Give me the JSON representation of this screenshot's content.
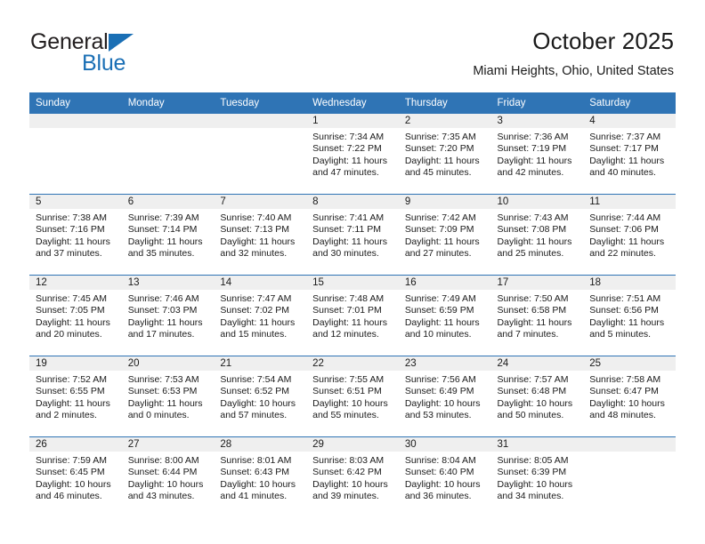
{
  "brand": {
    "name_part1": "General",
    "name_part2": "Blue",
    "flag_icon": "triangle-flag-icon"
  },
  "header": {
    "title": "October 2025",
    "subtitle": "Miami Heights, Ohio, United States"
  },
  "colors": {
    "header_blue": "#2f74b5",
    "brand_blue": "#1a6fb5",
    "daynum_strip": "#efefef",
    "text": "#1a1a1a"
  },
  "weekday_headers": [
    "Sunday",
    "Monday",
    "Tuesday",
    "Wednesday",
    "Thursday",
    "Friday",
    "Saturday"
  ],
  "weeks": [
    [
      {
        "day": "",
        "sunrise": "",
        "sunset": "",
        "daylight_line1": "",
        "daylight_line2": ""
      },
      {
        "day": "",
        "sunrise": "",
        "sunset": "",
        "daylight_line1": "",
        "daylight_line2": ""
      },
      {
        "day": "",
        "sunrise": "",
        "sunset": "",
        "daylight_line1": "",
        "daylight_line2": ""
      },
      {
        "day": "1",
        "sunrise": "Sunrise: 7:34 AM",
        "sunset": "Sunset: 7:22 PM",
        "daylight_line1": "Daylight: 11 hours",
        "daylight_line2": "and 47 minutes."
      },
      {
        "day": "2",
        "sunrise": "Sunrise: 7:35 AM",
        "sunset": "Sunset: 7:20 PM",
        "daylight_line1": "Daylight: 11 hours",
        "daylight_line2": "and 45 minutes."
      },
      {
        "day": "3",
        "sunrise": "Sunrise: 7:36 AM",
        "sunset": "Sunset: 7:19 PM",
        "daylight_line1": "Daylight: 11 hours",
        "daylight_line2": "and 42 minutes."
      },
      {
        "day": "4",
        "sunrise": "Sunrise: 7:37 AM",
        "sunset": "Sunset: 7:17 PM",
        "daylight_line1": "Daylight: 11 hours",
        "daylight_line2": "and 40 minutes."
      }
    ],
    [
      {
        "day": "5",
        "sunrise": "Sunrise: 7:38 AM",
        "sunset": "Sunset: 7:16 PM",
        "daylight_line1": "Daylight: 11 hours",
        "daylight_line2": "and 37 minutes."
      },
      {
        "day": "6",
        "sunrise": "Sunrise: 7:39 AM",
        "sunset": "Sunset: 7:14 PM",
        "daylight_line1": "Daylight: 11 hours",
        "daylight_line2": "and 35 minutes."
      },
      {
        "day": "7",
        "sunrise": "Sunrise: 7:40 AM",
        "sunset": "Sunset: 7:13 PM",
        "daylight_line1": "Daylight: 11 hours",
        "daylight_line2": "and 32 minutes."
      },
      {
        "day": "8",
        "sunrise": "Sunrise: 7:41 AM",
        "sunset": "Sunset: 7:11 PM",
        "daylight_line1": "Daylight: 11 hours",
        "daylight_line2": "and 30 minutes."
      },
      {
        "day": "9",
        "sunrise": "Sunrise: 7:42 AM",
        "sunset": "Sunset: 7:09 PM",
        "daylight_line1": "Daylight: 11 hours",
        "daylight_line2": "and 27 minutes."
      },
      {
        "day": "10",
        "sunrise": "Sunrise: 7:43 AM",
        "sunset": "Sunset: 7:08 PM",
        "daylight_line1": "Daylight: 11 hours",
        "daylight_line2": "and 25 minutes."
      },
      {
        "day": "11",
        "sunrise": "Sunrise: 7:44 AM",
        "sunset": "Sunset: 7:06 PM",
        "daylight_line1": "Daylight: 11 hours",
        "daylight_line2": "and 22 minutes."
      }
    ],
    [
      {
        "day": "12",
        "sunrise": "Sunrise: 7:45 AM",
        "sunset": "Sunset: 7:05 PM",
        "daylight_line1": "Daylight: 11 hours",
        "daylight_line2": "and 20 minutes."
      },
      {
        "day": "13",
        "sunrise": "Sunrise: 7:46 AM",
        "sunset": "Sunset: 7:03 PM",
        "daylight_line1": "Daylight: 11 hours",
        "daylight_line2": "and 17 minutes."
      },
      {
        "day": "14",
        "sunrise": "Sunrise: 7:47 AM",
        "sunset": "Sunset: 7:02 PM",
        "daylight_line1": "Daylight: 11 hours",
        "daylight_line2": "and 15 minutes."
      },
      {
        "day": "15",
        "sunrise": "Sunrise: 7:48 AM",
        "sunset": "Sunset: 7:01 PM",
        "daylight_line1": "Daylight: 11 hours",
        "daylight_line2": "and 12 minutes."
      },
      {
        "day": "16",
        "sunrise": "Sunrise: 7:49 AM",
        "sunset": "Sunset: 6:59 PM",
        "daylight_line1": "Daylight: 11 hours",
        "daylight_line2": "and 10 minutes."
      },
      {
        "day": "17",
        "sunrise": "Sunrise: 7:50 AM",
        "sunset": "Sunset: 6:58 PM",
        "daylight_line1": "Daylight: 11 hours",
        "daylight_line2": "and 7 minutes."
      },
      {
        "day": "18",
        "sunrise": "Sunrise: 7:51 AM",
        "sunset": "Sunset: 6:56 PM",
        "daylight_line1": "Daylight: 11 hours",
        "daylight_line2": "and 5 minutes."
      }
    ],
    [
      {
        "day": "19",
        "sunrise": "Sunrise: 7:52 AM",
        "sunset": "Sunset: 6:55 PM",
        "daylight_line1": "Daylight: 11 hours",
        "daylight_line2": "and 2 minutes."
      },
      {
        "day": "20",
        "sunrise": "Sunrise: 7:53 AM",
        "sunset": "Sunset: 6:53 PM",
        "daylight_line1": "Daylight: 11 hours",
        "daylight_line2": "and 0 minutes."
      },
      {
        "day": "21",
        "sunrise": "Sunrise: 7:54 AM",
        "sunset": "Sunset: 6:52 PM",
        "daylight_line1": "Daylight: 10 hours",
        "daylight_line2": "and 57 minutes."
      },
      {
        "day": "22",
        "sunrise": "Sunrise: 7:55 AM",
        "sunset": "Sunset: 6:51 PM",
        "daylight_line1": "Daylight: 10 hours",
        "daylight_line2": "and 55 minutes."
      },
      {
        "day": "23",
        "sunrise": "Sunrise: 7:56 AM",
        "sunset": "Sunset: 6:49 PM",
        "daylight_line1": "Daylight: 10 hours",
        "daylight_line2": "and 53 minutes."
      },
      {
        "day": "24",
        "sunrise": "Sunrise: 7:57 AM",
        "sunset": "Sunset: 6:48 PM",
        "daylight_line1": "Daylight: 10 hours",
        "daylight_line2": "and 50 minutes."
      },
      {
        "day": "25",
        "sunrise": "Sunrise: 7:58 AM",
        "sunset": "Sunset: 6:47 PM",
        "daylight_line1": "Daylight: 10 hours",
        "daylight_line2": "and 48 minutes."
      }
    ],
    [
      {
        "day": "26",
        "sunrise": "Sunrise: 7:59 AM",
        "sunset": "Sunset: 6:45 PM",
        "daylight_line1": "Daylight: 10 hours",
        "daylight_line2": "and 46 minutes."
      },
      {
        "day": "27",
        "sunrise": "Sunrise: 8:00 AM",
        "sunset": "Sunset: 6:44 PM",
        "daylight_line1": "Daylight: 10 hours",
        "daylight_line2": "and 43 minutes."
      },
      {
        "day": "28",
        "sunrise": "Sunrise: 8:01 AM",
        "sunset": "Sunset: 6:43 PM",
        "daylight_line1": "Daylight: 10 hours",
        "daylight_line2": "and 41 minutes."
      },
      {
        "day": "29",
        "sunrise": "Sunrise: 8:03 AM",
        "sunset": "Sunset: 6:42 PM",
        "daylight_line1": "Daylight: 10 hours",
        "daylight_line2": "and 39 minutes."
      },
      {
        "day": "30",
        "sunrise": "Sunrise: 8:04 AM",
        "sunset": "Sunset: 6:40 PM",
        "daylight_line1": "Daylight: 10 hours",
        "daylight_line2": "and 36 minutes."
      },
      {
        "day": "31",
        "sunrise": "Sunrise: 8:05 AM",
        "sunset": "Sunset: 6:39 PM",
        "daylight_line1": "Daylight: 10 hours",
        "daylight_line2": "and 34 minutes."
      },
      {
        "day": "",
        "sunrise": "",
        "sunset": "",
        "daylight_line1": "",
        "daylight_line2": ""
      }
    ]
  ]
}
